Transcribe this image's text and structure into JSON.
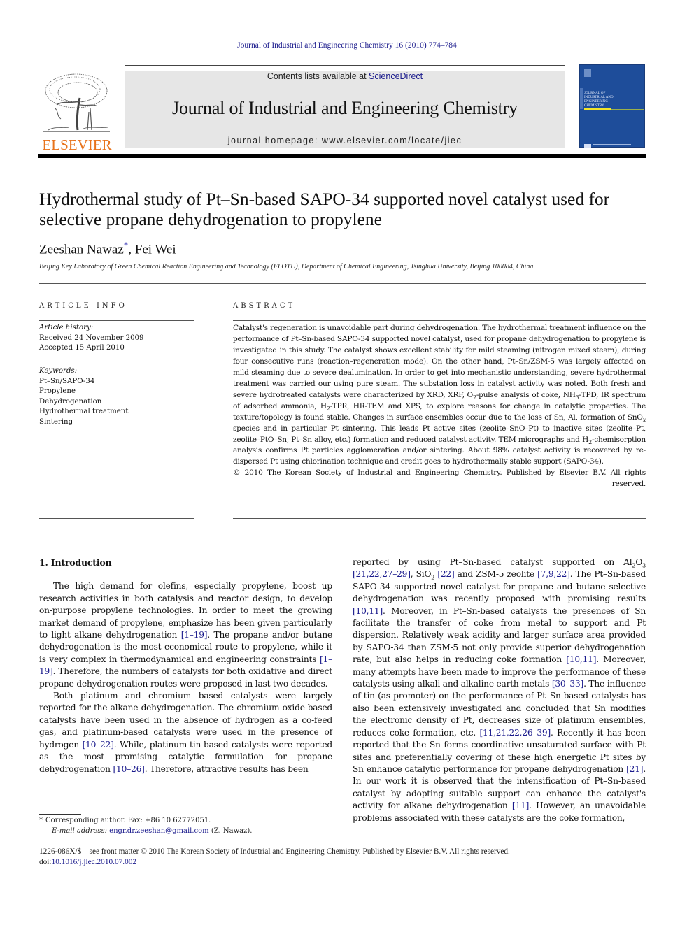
{
  "header": {
    "running_head": "Journal of Industrial and Engineering Chemistry 16 (2010) 774–784",
    "contents_prefix": "Contents lists available at ",
    "contents_link": "ScienceDirect",
    "journal_title": "Journal of Industrial and Engineering Chemistry",
    "homepage_prefix": "journal homepage: ",
    "homepage_url": "www.elsevier.com/locate/jiec",
    "publisher_logo": "ELSEVIER",
    "cover_title": "Journal of Industrial and Engineering Chemistry",
    "brand_color": "#e8731b",
    "cover_color": "#1e4d9a",
    "link_color": "#1a1a8c"
  },
  "article": {
    "title": "Hydrothermal study of Pt–Sn-based SAPO-34 supported novel catalyst used for selective propane dehydrogenation to propylene",
    "authors": [
      {
        "name": "Zeeshan Nawaz",
        "marker": "*"
      },
      {
        "name": "Fei Wei",
        "marker": ""
      }
    ],
    "author_separator": ", ",
    "affiliation": "Beijing Key Laboratory of Green Chemical Reaction Engineering and Technology (FLOTU), Department of Chemical Engineering, Tsinghua University, Beijing 100084, China"
  },
  "article_info": {
    "heading": "ARTICLE INFO",
    "history_label": "Article history:",
    "received": "Received 24 November 2009",
    "accepted": "Accepted 15 April 2010",
    "keywords_label": "Keywords:",
    "keywords": [
      "Pt–Sn/SAPO-34",
      "Propylene",
      "Dehydrogenation",
      "Hydrothermal treatment",
      "Sintering"
    ]
  },
  "abstract": {
    "heading": "ABSTRACT",
    "text_1": "Catalyst's regeneration is unavoidable part during dehydrogenation. The hydrothermal treatment influence on the performance of Pt–Sn-based SAPO-34 supported novel catalyst, used for propane dehydrogenation to propylene is investigated in this study. The catalyst shows excellent stability for mild steaming (nitrogen mixed steam), during four consecutive runs (reaction–regeneration mode). On the other hand, Pt–Sn/ZSM-5 was largely affected on mild steaming due to severe dealumination. In order to get into mechanistic understanding, severe hydrothermal treatment was carried our using pure steam. The substation loss in catalyst activity was noted. Both fresh and severe hydrotreated catalysts were characterized by XRD, XRF, O",
    "sub_1": "2",
    "text_2": "-pulse analysis of coke, NH",
    "sub_2": "3",
    "text_3": "-TPD, IR spectrum of adsorbed ammonia, H",
    "sub_3": "2",
    "text_4": "-TPR, HR-TEM and XPS, to explore reasons for change in catalytic properties. The texture/topology is found stable. Changes in surface ensembles occur due to the loss of Sn, Al, formation of SnO",
    "sub_4": "x",
    "text_5": " species and in particular Pt sintering. This leads Pt active sites (zeolite–SnO–Pt) to inactive sites (zeolite–Pt, zeolite–PtO–Sn, Pt–Sn alloy, etc.) formation and reduced catalyst activity. TEM micrographs and H",
    "sub_5": "2",
    "text_6": "-chemisorption analysis confirms Pt particles agglomeration and/or sintering. About 98% catalyst activity is recovered by re-dispersed Pt using chlorination technique and credit goes to hydrothermally stable support (SAPO-34).",
    "copyright": "© 2010 The Korean Society of Industrial and Engineering Chemistry. Published by Elsevier B.V. All rights reserved."
  },
  "introduction": {
    "heading": "1.  Introduction",
    "p1": [
      {
        "t": "The high demand for olefins, especially propylene, boost up research activities in both catalysis and reactor design, to develop on-purpose propylene technologies. In order to meet the growing market demand of propylene, emphasize has been given particularly to light alkane dehydrogenation "
      },
      {
        "ref": "[1–19]"
      },
      {
        "t": ". The propane and/or butane dehydrogenation is the most economical route to propylene, while it is very complex in thermodynamical and engineering constraints "
      },
      {
        "ref": "[1–19]"
      },
      {
        "t": ". Therefore, the numbers of catalysts for both oxidative and direct propane dehydrogenation routes were proposed in last two decades."
      }
    ],
    "p2": [
      {
        "t": "Both platinum and chromium based catalysts were largely reported for the alkane dehydrogenation. The chromium oxide-based catalysts have been used in the absence of hydrogen as a co-feed gas, and platinum-based catalysts were used in the presence of hydrogen "
      },
      {
        "ref": "[10–22]"
      },
      {
        "t": ". While, platinum-tin-based catalysts were reported as the most promising catalytic formulation for propane dehydrogenation "
      },
      {
        "ref": "[10–26]"
      },
      {
        "t": ". Therefore, attractive results has been"
      }
    ],
    "p3": [
      {
        "t": "reported by using Pt–Sn-based catalyst supported on Al"
      },
      {
        "sub": "2"
      },
      {
        "t": "O"
      },
      {
        "sub": "3"
      },
      {
        "t": " "
      },
      {
        "ref": "[21,22,27–29]"
      },
      {
        "t": ", SiO"
      },
      {
        "sub": "2"
      },
      {
        "t": " "
      },
      {
        "ref": "[22]"
      },
      {
        "t": " and ZSM-5 zeolite "
      },
      {
        "ref": "[7,9,22]"
      },
      {
        "t": ". The Pt–Sn-based SAPO-34 supported novel catalyst for propane and butane selective dehydrogenation was recently proposed with promising results "
      },
      {
        "ref": "[10,11]"
      },
      {
        "t": ". Moreover, in Pt–Sn-based catalysts the presences of Sn facilitate the transfer of coke from metal to support and Pt dispersion. Relatively weak acidity and larger surface area provided by SAPO-34 than ZSM-5 not only provide superior dehydrogenation rate, but also helps in reducing coke formation "
      },
      {
        "ref": "[10,11]"
      },
      {
        "t": ". Moreover, many attempts have been made to improve the performance of these catalysts using alkali and alkaline earth metals "
      },
      {
        "ref": "[30–33]"
      },
      {
        "t": ". The influence of tin (as promoter) on the performance of Pt–Sn-based catalysts has also been extensively investigated and concluded that Sn modifies the electronic density of Pt, decreases size of platinum ensembles, reduces coke formation, etc. "
      },
      {
        "ref": "[11,21,22,26–39]"
      },
      {
        "t": ". Recently it has been reported that the Sn forms coordinative unsaturated surface with Pt sites and preferentially covering of these high energetic Pt sites by Sn enhance catalytic performance for propane dehydrogenation "
      },
      {
        "ref": "[21]"
      },
      {
        "t": ". In our work it is observed that the intensification of Pt–Sn-based catalyst by adopting suitable support can enhance the catalyst's activity for alkane dehydrogenation "
      },
      {
        "ref": "[11]"
      },
      {
        "t": ". However, an unavoidable problems associated with these catalysts are the coke formation,"
      }
    ]
  },
  "footnote": {
    "marker": "*",
    "text": "Corresponding author. Fax: +86 10 62772051.",
    "email_label": "E-mail address: ",
    "email": "engr.dr.zeeshan@gmail.com",
    "email_suffix": " (Z. Nawaz)."
  },
  "bottom_matter": {
    "issn_line": "1226-086X/$ – see front matter © 2010 The Korean Society of Industrial and Engineering Chemistry. Published by Elsevier B.V. All rights reserved.",
    "doi_label": "doi:",
    "doi": "10.1016/j.jiec.2010.07.002"
  }
}
